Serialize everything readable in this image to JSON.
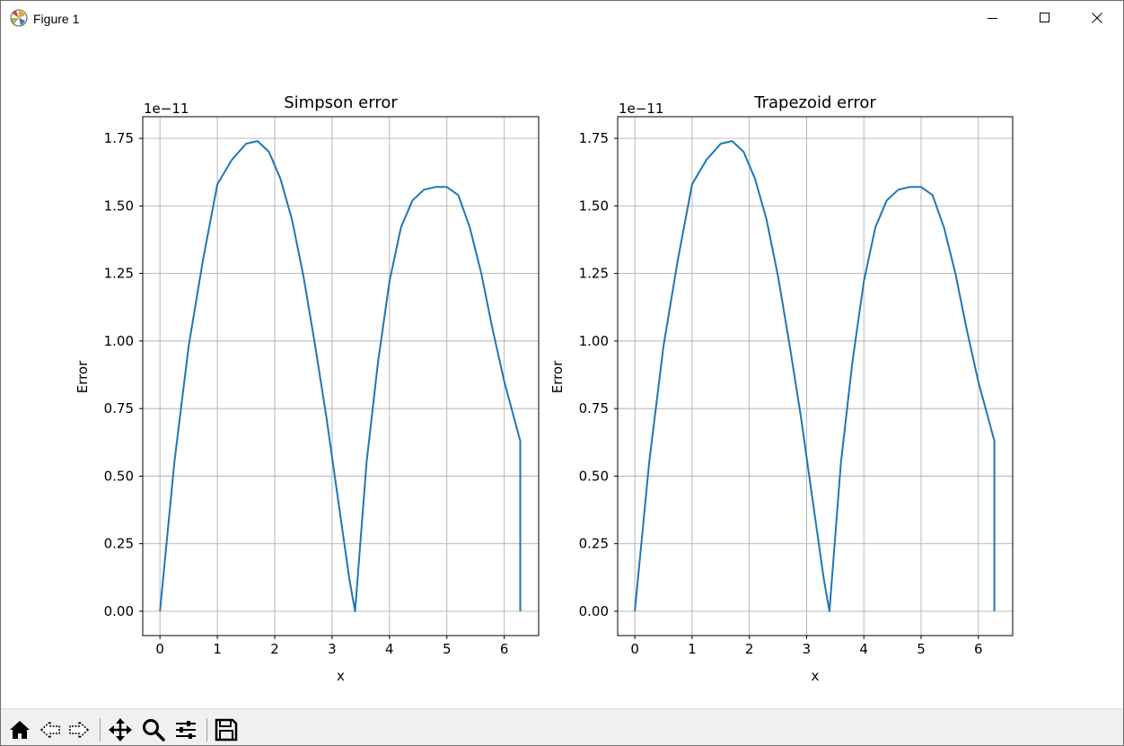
{
  "window": {
    "title": "Figure 1",
    "icons": [
      "matplotlib-logo-icon",
      "minimize-icon",
      "maximize-icon",
      "close-icon"
    ]
  },
  "toolbar": {
    "items": [
      {
        "name": "home-icon",
        "tooltip": "Reset original view"
      },
      {
        "name": "back-icon",
        "tooltip": "Back to previous view"
      },
      {
        "name": "forward-icon",
        "tooltip": "Forward to next view"
      },
      {
        "name": "pan-icon",
        "tooltip": "Pan axes"
      },
      {
        "name": "zoom-icon",
        "tooltip": "Zoom to rectangle"
      },
      {
        "name": "configure-subplots-icon",
        "tooltip": "Configure subplots"
      },
      {
        "name": "save-icon",
        "tooltip": "Save the figure"
      }
    ]
  },
  "chart_data": [
    {
      "type": "line",
      "title": "Simpson error",
      "xlabel": "x",
      "ylabel": "Error",
      "offset_text": "1e−11",
      "xlim": [
        -0.3,
        6.6
      ],
      "ylim": [
        -0.09,
        1.83
      ],
      "xticks": [
        0,
        1,
        2,
        3,
        4,
        5,
        6
      ],
      "xtick_labels": [
        "0",
        "1",
        "2",
        "3",
        "4",
        "5",
        "6"
      ],
      "yticks": [
        0.0,
        0.25,
        0.5,
        0.75,
        1.0,
        1.25,
        1.5,
        1.75
      ],
      "ytick_labels": [
        "0.00",
        "0.25",
        "0.50",
        "0.75",
        "1.00",
        "1.25",
        "1.50",
        "1.75"
      ],
      "grid": true,
      "series_color": "#1f77b4",
      "x": [
        0,
        0.25,
        0.5,
        0.75,
        1.0,
        1.25,
        1.5,
        1.7,
        1.9,
        2.1,
        2.3,
        2.5,
        2.7,
        2.9,
        3.1,
        3.3,
        3.4,
        3.6,
        3.8,
        4.0,
        4.2,
        4.4,
        4.6,
        4.8,
        5.0,
        5.2,
        5.4,
        5.6,
        5.8,
        6.0,
        6.28,
        6.28
      ],
      "y": [
        0.0,
        0.55,
        0.98,
        1.3,
        1.58,
        1.67,
        1.73,
        1.74,
        1.7,
        1.6,
        1.45,
        1.24,
        0.99,
        0.72,
        0.42,
        0.12,
        0.0,
        0.55,
        0.92,
        1.22,
        1.42,
        1.52,
        1.56,
        1.57,
        1.57,
        1.54,
        1.42,
        1.25,
        1.04,
        0.85,
        0.63,
        0.0
      ]
    },
    {
      "type": "line",
      "title": "Trapezoid error",
      "xlabel": "x",
      "ylabel": "Error",
      "offset_text": "1e−11",
      "xlim": [
        -0.3,
        6.6
      ],
      "ylim": [
        -0.09,
        1.83
      ],
      "xticks": [
        0,
        1,
        2,
        3,
        4,
        5,
        6
      ],
      "xtick_labels": [
        "0",
        "1",
        "2",
        "3",
        "4",
        "5",
        "6"
      ],
      "yticks": [
        0.0,
        0.25,
        0.5,
        0.75,
        1.0,
        1.25,
        1.5,
        1.75
      ],
      "ytick_labels": [
        "0.00",
        "0.25",
        "0.50",
        "0.75",
        "1.00",
        "1.25",
        "1.50",
        "1.75"
      ],
      "grid": true,
      "series_color": "#1f77b4",
      "x": [
        0,
        0.25,
        0.5,
        0.75,
        1.0,
        1.25,
        1.5,
        1.7,
        1.9,
        2.1,
        2.3,
        2.5,
        2.7,
        2.9,
        3.1,
        3.3,
        3.4,
        3.6,
        3.8,
        4.0,
        4.2,
        4.4,
        4.6,
        4.8,
        5.0,
        5.2,
        5.4,
        5.6,
        5.8,
        6.0,
        6.28,
        6.28
      ],
      "y": [
        0.0,
        0.55,
        0.98,
        1.3,
        1.58,
        1.67,
        1.73,
        1.74,
        1.7,
        1.6,
        1.45,
        1.24,
        0.99,
        0.72,
        0.42,
        0.12,
        0.0,
        0.55,
        0.92,
        1.22,
        1.42,
        1.52,
        1.56,
        1.57,
        1.57,
        1.54,
        1.42,
        1.25,
        1.04,
        0.85,
        0.63,
        0.0
      ]
    }
  ]
}
